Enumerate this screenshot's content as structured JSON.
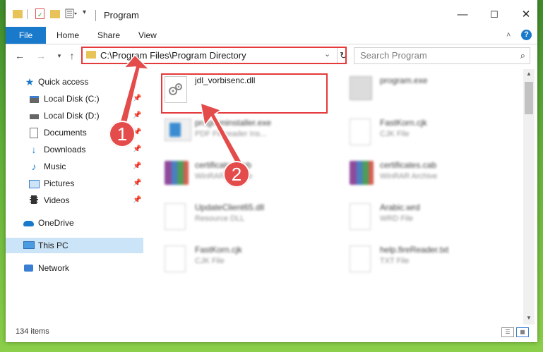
{
  "window": {
    "title": "Program",
    "controls": {
      "minimize": "—",
      "maximize": "☐",
      "close": "✕"
    }
  },
  "ribbon": {
    "tabs": [
      {
        "label": "File"
      },
      {
        "label": "Home"
      },
      {
        "label": "Share"
      },
      {
        "label": "View"
      }
    ],
    "collapse_icon": "chevron-up-icon",
    "help_icon": "help-icon"
  },
  "address_bar": {
    "path": "C:\\Program Files\\Program Directory"
  },
  "search": {
    "placeholder": "Search Program"
  },
  "nav_pane": {
    "items": [
      {
        "label": "Quick access",
        "icon": "star-icon"
      },
      {
        "label": "Local Disk (C:)",
        "icon": "drive-icon"
      },
      {
        "label": "Local Disk (D:)",
        "icon": "drive-icon"
      },
      {
        "label": "Documents",
        "icon": "documents-icon"
      },
      {
        "label": "Downloads",
        "icon": "downloads-icon"
      },
      {
        "label": "Music",
        "icon": "music-icon"
      },
      {
        "label": "Pictures",
        "icon": "pictures-icon"
      },
      {
        "label": "Videos",
        "icon": "videos-icon"
      },
      {
        "label": "OneDrive",
        "icon": "cloud-icon"
      },
      {
        "label": "This PC",
        "icon": "computer-icon"
      },
      {
        "label": "Network",
        "icon": "network-icon"
      }
    ]
  },
  "files": [
    {
      "name": "jdl_vorbisenc.dll",
      "type": ""
    },
    {
      "name": "program.exe",
      "type": ""
    },
    {
      "name": "programinstaller.exe",
      "type": "PDF Filereader Ins..."
    },
    {
      "name": "FastKorn.cjk",
      "type": "CJK File"
    },
    {
      "name": "certificates.cab",
      "type": "WinRAR Archive"
    },
    {
      "name": "certificates.cab",
      "type": "WinRAR Archive"
    },
    {
      "name": "UpdateClient65.dll",
      "type": "Resource DLL"
    },
    {
      "name": "Arabic.wrd",
      "type": "WRD File"
    },
    {
      "name": "FastKorn.cjk",
      "type": "CJK File"
    },
    {
      "name": "help.fireReader.txt",
      "type": "TXT File"
    }
  ],
  "status_bar": {
    "item_count": "134 items"
  },
  "callouts": {
    "badge1": "1",
    "badge2": "2"
  },
  "colors": {
    "accent": "#1979ca",
    "highlight": "#e5393b",
    "badge": "#e44b4b"
  }
}
